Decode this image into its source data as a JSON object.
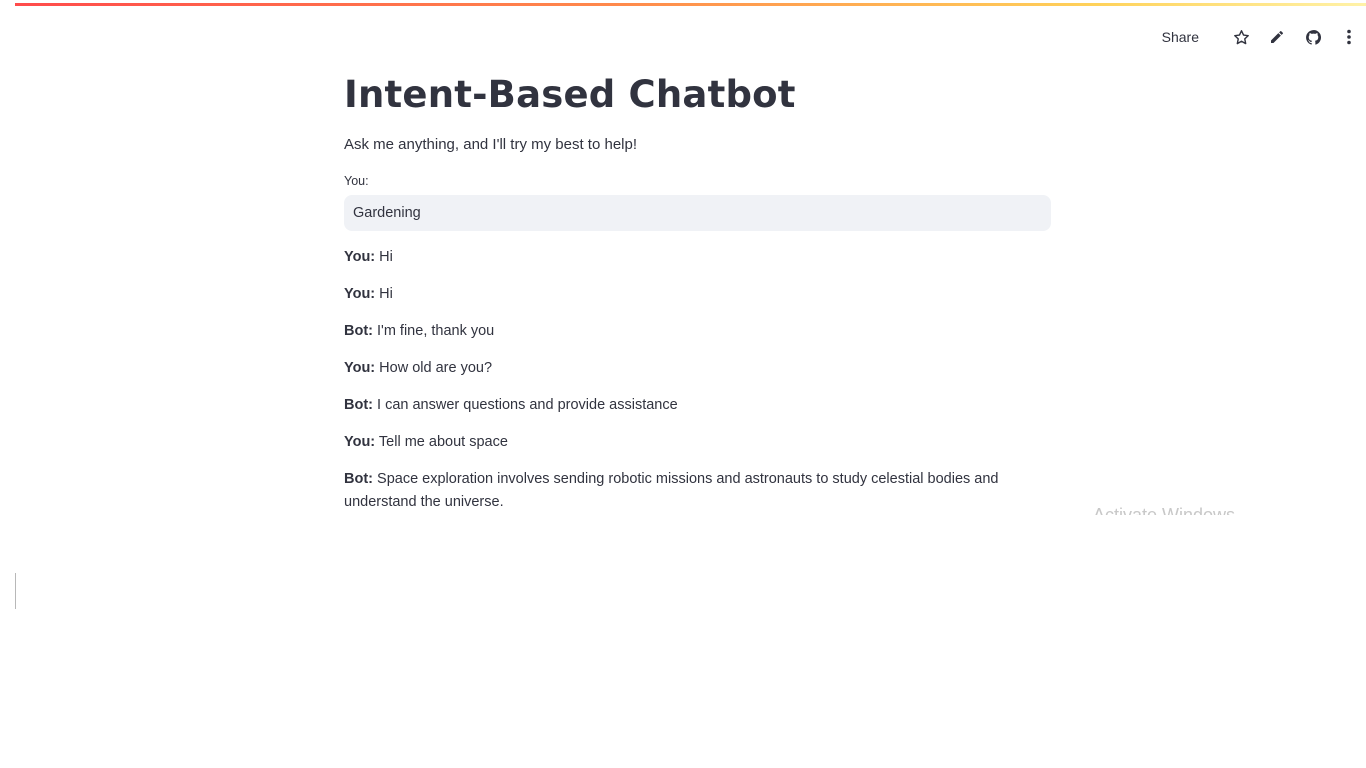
{
  "colors": {
    "accent_gradient": [
      "#ff4b4b",
      "#ffd25a"
    ],
    "input_bg": "#f0f2f6",
    "text": "#31333f"
  },
  "toolbar": {
    "share_label": "Share",
    "icons": [
      "star-icon",
      "pencil-icon",
      "github-icon",
      "more-vertical-icon"
    ]
  },
  "header": {
    "title": "Intent-Based Chatbot",
    "subtitle": "Ask me anything, and I'll try my best to help!"
  },
  "chat_input": {
    "label": "You:",
    "value": "Gardening"
  },
  "messages": [
    {
      "speaker": "You:",
      "text": "Hi"
    },
    {
      "speaker": "You:",
      "text": "Hi"
    },
    {
      "speaker": "Bot:",
      "text": "I'm fine, thank you"
    },
    {
      "speaker": "You:",
      "text": "How old are you?"
    },
    {
      "speaker": "Bot:",
      "text": "I can answer questions and provide assistance"
    },
    {
      "speaker": "You:",
      "text": "Tell me about space"
    },
    {
      "speaker": "Bot:",
      "text": "Space exploration involves sending robotic missions and astronauts to study celestial bodies and understand the universe."
    }
  ],
  "watermark": "Activate Windows"
}
